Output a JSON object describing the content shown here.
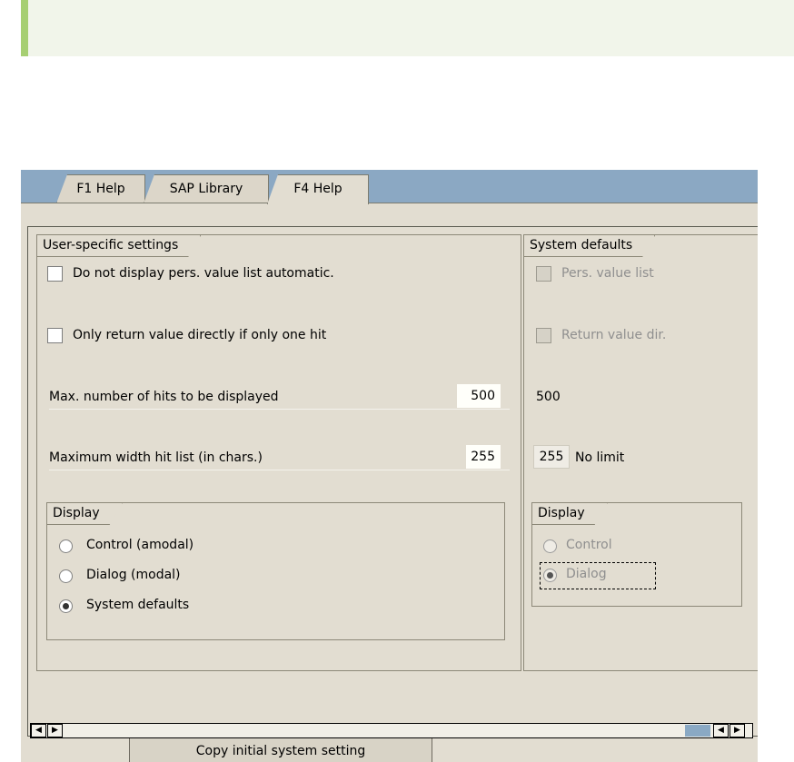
{
  "tabs": [
    {
      "label": "F1 Help",
      "active": false
    },
    {
      "label": "SAP Library",
      "active": false
    },
    {
      "label": "F4 Help",
      "active": true
    }
  ],
  "user_settings": {
    "title": "User-specific settings",
    "no_auto_list_label": "Do not display pers. value list automatic.",
    "no_auto_list_checked": false,
    "return_direct_label": "Only return value directly if only one hit",
    "return_direct_checked": false,
    "max_hits_label": "Max. number of hits to be displayed",
    "max_hits_value": "500",
    "max_width_label": "Maximum width hit list (in chars.)",
    "max_width_value": "255",
    "display": {
      "title": "Display",
      "options": [
        "Control (amodal)",
        "Dialog (modal)",
        "System defaults"
      ],
      "selected": "System defaults"
    }
  },
  "system_defaults": {
    "title": "System defaults",
    "pers_list_label": "Pers. value list",
    "return_direct_label": "Return value dir.",
    "max_hits_value": "500",
    "max_width_value": "255",
    "max_width_suffix": "No limit",
    "display": {
      "title": "Display",
      "options": [
        "Control",
        "Dialog"
      ],
      "selected": "Dialog"
    }
  },
  "copy_button_label": "Copy initial system setting",
  "scroll": {
    "left_arrow": "◀",
    "right_arrow": "▶"
  },
  "colors": {
    "tabstrip": "#8ba8c3",
    "background": "#e2ddd1",
    "banner_accent": "#a6cf72"
  }
}
